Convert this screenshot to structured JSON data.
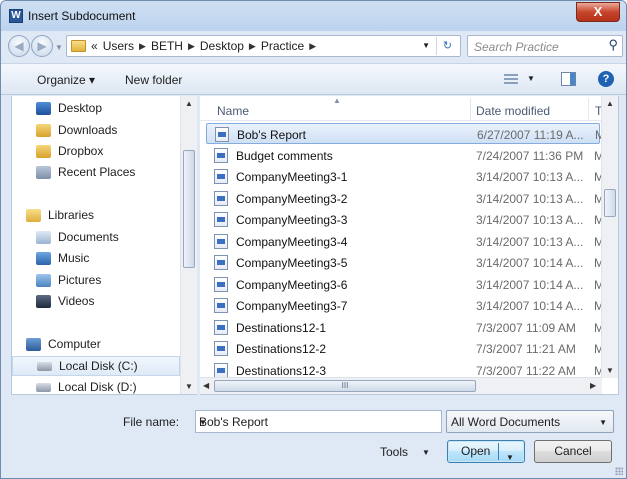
{
  "window": {
    "title": "Insert Subdocument",
    "app_icon": "W",
    "close_label": "X"
  },
  "address": {
    "overflow": "«",
    "crumbs": [
      "Users",
      "BETH",
      "Desktop",
      "Practice"
    ],
    "search_placeholder": "Search Practice"
  },
  "toolbar": {
    "organize_label": "Organize ▾",
    "new_folder_label": "New folder"
  },
  "nav": {
    "items": [
      {
        "label": "Desktop",
        "icon": "desktop-icon"
      },
      {
        "label": "Downloads",
        "icon": "downloads-icon"
      },
      {
        "label": "Dropbox",
        "icon": "dropbox-icon"
      },
      {
        "label": "Recent Places",
        "icon": "recent-places-icon"
      },
      {
        "label": "Libraries",
        "icon": "libraries-icon"
      },
      {
        "label": "Documents",
        "icon": "documents-icon"
      },
      {
        "label": "Music",
        "icon": "music-icon"
      },
      {
        "label": "Pictures",
        "icon": "pictures-icon"
      },
      {
        "label": "Videos",
        "icon": "videos-icon"
      },
      {
        "label": "Computer",
        "icon": "computer-icon"
      },
      {
        "label": "Local Disk (C:)",
        "icon": "drive-icon"
      },
      {
        "label": "Local Disk (D:)",
        "icon": "drive-icon"
      }
    ]
  },
  "files": {
    "columns": {
      "name": "Name",
      "date": "Date modified",
      "type": "Typ"
    },
    "rows": [
      {
        "name": "Bob's Report",
        "date": "6/27/2007 11:19 A...",
        "type": "Mic"
      },
      {
        "name": "Budget comments",
        "date": "7/24/2007 11:36 PM",
        "type": "Mic"
      },
      {
        "name": "CompanyMeeting3-1",
        "date": "3/14/2007 10:13 A...",
        "type": "Mic"
      },
      {
        "name": "CompanyMeeting3-2",
        "date": "3/14/2007 10:13 A...",
        "type": "Mic"
      },
      {
        "name": "CompanyMeeting3-3",
        "date": "3/14/2007 10:13 A...",
        "type": "Mic"
      },
      {
        "name": "CompanyMeeting3-4",
        "date": "3/14/2007 10:13 A...",
        "type": "Mic"
      },
      {
        "name": "CompanyMeeting3-5",
        "date": "3/14/2007 10:14 A...",
        "type": "Mic"
      },
      {
        "name": "CompanyMeeting3-6",
        "date": "3/14/2007 10:14 A...",
        "type": "Mic"
      },
      {
        "name": "CompanyMeeting3-7",
        "date": "3/14/2007 10:14 A...",
        "type": "Mic"
      },
      {
        "name": "Destinations12-1",
        "date": "7/3/2007 11:09 AM",
        "type": "Mic"
      },
      {
        "name": "Destinations12-2",
        "date": "7/3/2007 11:21 AM",
        "type": "Mic"
      },
      {
        "name": "Destinations12-3",
        "date": "7/3/2007 11:22 AM",
        "type": "Mic"
      }
    ],
    "hscroll_grip": "III"
  },
  "bottom": {
    "file_name_label": "File name:",
    "file_name_value": "Bob's Report",
    "file_type_value": "All Word Documents",
    "tools_label": "Tools",
    "open_label": "Open",
    "cancel_label": "Cancel"
  }
}
